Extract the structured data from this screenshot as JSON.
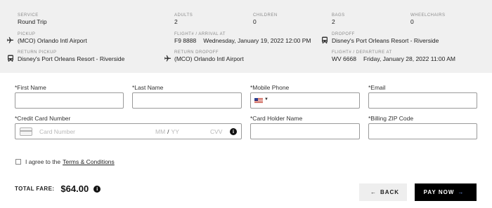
{
  "summary": {
    "service": {
      "label": "SERVICE",
      "value": "Round Trip"
    },
    "adults": {
      "label": "ADULTS",
      "value": "2"
    },
    "children": {
      "label": "CHILDREN",
      "value": "0"
    },
    "bags": {
      "label": "BAGS",
      "value": "2"
    },
    "wheelchairs": {
      "label": "WHEELCHAIRS",
      "value": "0"
    },
    "pickup": {
      "label": "PICKUP",
      "value": "(MCO) Orlando Intl Airport",
      "icon": "airplane-icon"
    },
    "arrival": {
      "label": "FLIGHT# / ARRIVAL AT",
      "flight": "F9 8888",
      "datetime": "Wednesday, January 19, 2022 12:00 PM"
    },
    "dropoff": {
      "label": "DROPOFF",
      "value": "Disney's Port Orleans Resort - Riverside",
      "icon": "bus-icon"
    },
    "return_pickup": {
      "label": "RETURN PICKUP",
      "value": "Disney's Port Orleans Resort - Riverside",
      "icon": "bus-icon"
    },
    "return_dropoff": {
      "label": "RETURN DROPOFF",
      "value": "(MCO) Orlando Intl Airport",
      "icon": "airplane-icon"
    },
    "departure": {
      "label": "FLIGHT# / DEPARTURE AT",
      "flight": "WV 6668",
      "datetime": "Friday, January 28, 2022 11:00 AM"
    }
  },
  "form": {
    "first_name": {
      "label": "*First Name",
      "value": ""
    },
    "last_name": {
      "label": "*Last Name",
      "value": ""
    },
    "mobile_phone": {
      "label": "*Mobile Phone",
      "value": "",
      "country_flag": "us-flag-icon"
    },
    "email": {
      "label": "*Email",
      "value": ""
    },
    "credit_card": {
      "label": "*Credit Card Number",
      "number_placeholder": "Card Number",
      "mm_placeholder": "MM",
      "yy_placeholder": "YY",
      "cvv_placeholder": "CVV"
    },
    "card_holder": {
      "label": "*Card Holder Name",
      "value": ""
    },
    "billing_zip": {
      "label": "*Billing ZIP Code",
      "value": ""
    }
  },
  "agree": {
    "prefix": "I agree to the",
    "link": "Terms & Conditions"
  },
  "total": {
    "label": "TOTAL FARE:",
    "amount": "$64.00"
  },
  "buttons": {
    "back": "BACK",
    "pay": "PAY NOW"
  },
  "colors": {
    "summary_bg": "#f0f0f0",
    "pay_button": "#000000",
    "back_button": "#eeeeee",
    "arrow_accent": "#7ea8ff"
  }
}
